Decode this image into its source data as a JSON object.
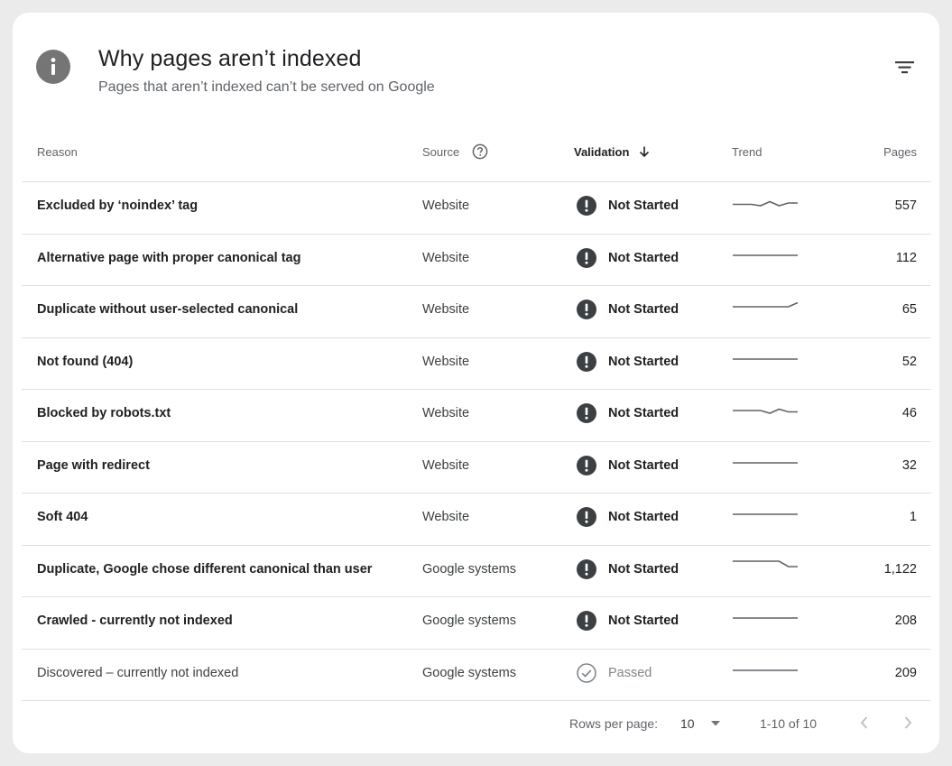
{
  "header": {
    "title": "Why pages aren’t indexed",
    "subtitle": "Pages that aren’t indexed can’t be served on Google",
    "info_icon": "info-icon",
    "filter_icon": "filter-icon"
  },
  "table": {
    "columns": {
      "reason": "Reason",
      "source": "Source",
      "validation": "Validation",
      "trend": "Trend",
      "pages": "Pages"
    },
    "rows": [
      {
        "reason": "Excluded by ‘noindex’ tag",
        "source": "Website",
        "validation": "Not Started",
        "pages": "557",
        "trend": [
          0.55,
          0.55,
          0.55,
          0.6,
          0.45,
          0.6,
          0.5,
          0.5
        ]
      },
      {
        "reason": "Alternative page with proper canonical tag",
        "source": "Website",
        "validation": "Not Started",
        "pages": "112",
        "trend": [
          0.5,
          0.5,
          0.5,
          0.5,
          0.5,
          0.5,
          0.5,
          0.5
        ]
      },
      {
        "reason": "Duplicate without user-selected canonical",
        "source": "Website",
        "validation": "Not Started",
        "pages": "65",
        "trend": [
          0.5,
          0.5,
          0.5,
          0.5,
          0.5,
          0.5,
          0.5,
          0.35
        ]
      },
      {
        "reason": "Not found (404)",
        "source": "Website",
        "validation": "Not Started",
        "pages": "52",
        "trend": [
          0.5,
          0.5,
          0.5,
          0.5,
          0.5,
          0.5,
          0.5,
          0.5
        ]
      },
      {
        "reason": "Blocked by robots.txt",
        "source": "Website",
        "validation": "Not Started",
        "pages": "46",
        "trend": [
          0.5,
          0.5,
          0.5,
          0.5,
          0.6,
          0.45,
          0.55,
          0.55
        ]
      },
      {
        "reason": "Page with redirect",
        "source": "Website",
        "validation": "Not Started",
        "pages": "32",
        "trend": [
          0.5,
          0.5,
          0.5,
          0.5,
          0.5,
          0.5,
          0.5,
          0.5
        ]
      },
      {
        "reason": "Soft 404",
        "source": "Website",
        "validation": "Not Started",
        "pages": "1",
        "trend": [
          0.5,
          0.5,
          0.5,
          0.5,
          0.5,
          0.5,
          0.5,
          0.5
        ]
      },
      {
        "reason": "Duplicate, Google chose different canonical than user",
        "source": "Google systems",
        "validation": "Not Started",
        "pages": "1,122",
        "trend": [
          0.3,
          0.3,
          0.3,
          0.3,
          0.3,
          0.3,
          0.5,
          0.5
        ]
      },
      {
        "reason": "Crawled - currently not indexed",
        "source": "Google systems",
        "validation": "Not Started",
        "pages": "208",
        "trend": [
          0.5,
          0.5,
          0.5,
          0.5,
          0.5,
          0.5,
          0.5,
          0.5
        ]
      },
      {
        "reason": "Discovered – currently not indexed",
        "source": "Google systems",
        "validation": "Passed",
        "pages": "209",
        "trend": [
          0.5,
          0.5,
          0.5,
          0.5,
          0.5,
          0.5,
          0.5,
          0.5
        ]
      }
    ]
  },
  "footer": {
    "rows_per_page_label": "Rows per page:",
    "rows_per_page_value": "10",
    "range": "1-10 of 10"
  },
  "colors": {
    "not_started": "#3c4043",
    "passed": "#80868b",
    "trend_line": "#5f6368",
    "divider": "#e0e0e0"
  }
}
